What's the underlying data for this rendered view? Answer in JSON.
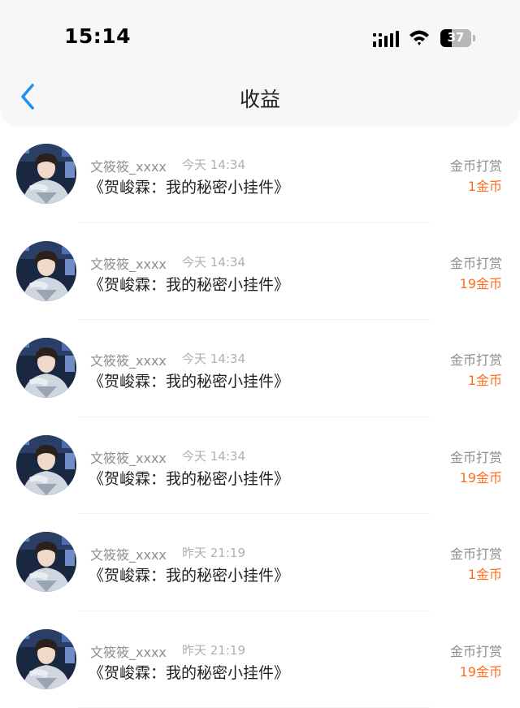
{
  "status_bar": {
    "time": "15:14",
    "battery_level": "37",
    "battery_fraction": 0.37
  },
  "nav": {
    "title": "收益",
    "back_icon": "chevron-left-icon",
    "accent_color": "#1e8ff5"
  },
  "colors": {
    "amount": "#ff6d1f",
    "secondary_text": "#8e8e8e"
  },
  "records": [
    {
      "username": "文筱筱_xxxx",
      "time": "今天 14:34",
      "work_title": "《贺峻霖：我的秘密小挂件》",
      "reward_type": "金币打赏",
      "amount": "1金币"
    },
    {
      "username": "文筱筱_xxxx",
      "time": "今天 14:34",
      "work_title": "《贺峻霖：我的秘密小挂件》",
      "reward_type": "金币打赏",
      "amount": "19金币"
    },
    {
      "username": "文筱筱_xxxx",
      "time": "今天 14:34",
      "work_title": "《贺峻霖：我的秘密小挂件》",
      "reward_type": "金币打赏",
      "amount": "1金币"
    },
    {
      "username": "文筱筱_xxxx",
      "time": "今天 14:34",
      "work_title": "《贺峻霖：我的秘密小挂件》",
      "reward_type": "金币打赏",
      "amount": "19金币"
    },
    {
      "username": "文筱筱_xxxx",
      "time": "昨天 21:19",
      "work_title": "《贺峻霖：我的秘密小挂件》",
      "reward_type": "金币打赏",
      "amount": "1金币"
    },
    {
      "username": "文筱筱_xxxx",
      "time": "昨天 21:19",
      "work_title": "《贺峻霖：我的秘密小挂件》",
      "reward_type": "金币打赏",
      "amount": "19金币"
    }
  ]
}
